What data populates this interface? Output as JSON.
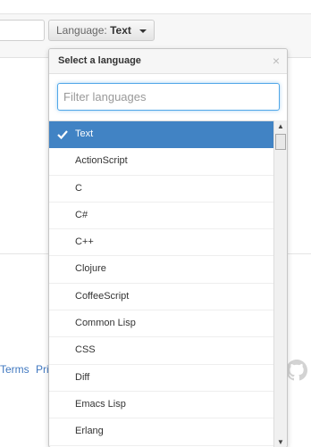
{
  "toolbar": {
    "language_prefix": "Language:",
    "language_value": "Text"
  },
  "popup": {
    "title": "Select a language",
    "close_label": "×",
    "filter_placeholder": "Filter languages",
    "languages": [
      {
        "label": "Text",
        "selected": true
      },
      {
        "label": "ActionScript",
        "selected": false
      },
      {
        "label": "C",
        "selected": false
      },
      {
        "label": "C#",
        "selected": false
      },
      {
        "label": "C++",
        "selected": false
      },
      {
        "label": "Clojure",
        "selected": false
      },
      {
        "label": "CoffeeScript",
        "selected": false
      },
      {
        "label": "Common Lisp",
        "selected": false
      },
      {
        "label": "CSS",
        "selected": false
      },
      {
        "label": "Diff",
        "selected": false
      },
      {
        "label": "Emacs Lisp",
        "selected": false
      },
      {
        "label": "Erlang",
        "selected": false
      }
    ]
  },
  "footer": {
    "terms_label": "Terms",
    "privacy_label": "Pri"
  },
  "icons": {
    "check": "check-icon",
    "caret": "caret-down-icon",
    "scroll_up": "▲",
    "scroll_down": "▼",
    "logo": "github-octocat-icon"
  },
  "colors": {
    "selected_bg": "#4183c4",
    "focus_border": "#51a7e8",
    "link": "#4078c0"
  }
}
